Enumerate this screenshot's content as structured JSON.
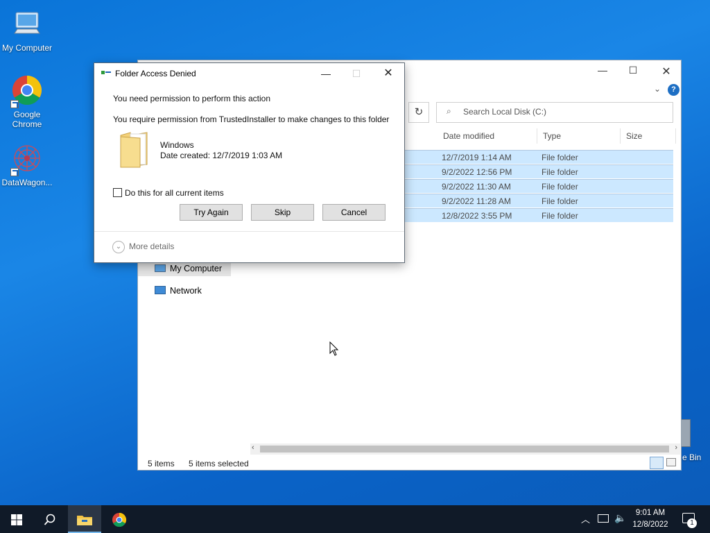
{
  "desktop": {
    "icons": [
      {
        "label": "My Computer"
      },
      {
        "label": "Google Chrome"
      },
      {
        "label": "DataWagon..."
      },
      {
        "label": "e Bin"
      }
    ]
  },
  "explorer": {
    "search_placeholder": "Search Local Disk (C:)",
    "columns": {
      "date": "Date modified",
      "type": "Type",
      "size": "Size"
    },
    "rows": [
      {
        "date": "12/7/2019 1:14 AM",
        "type": "File folder"
      },
      {
        "date": "9/2/2022 12:56 PM",
        "type": "File folder"
      },
      {
        "date": "9/2/2022 11:30 AM",
        "type": "File folder"
      },
      {
        "date": "9/2/2022 11:28 AM",
        "type": "File folder"
      },
      {
        "date": "12/8/2022 3:55 PM",
        "type": "File folder"
      }
    ],
    "nav": {
      "my_computer": "My Computer",
      "network": "Network"
    },
    "status": {
      "items": "5 items",
      "selected": "5 items selected"
    }
  },
  "dialog": {
    "title": "Folder Access Denied",
    "line1": "You need permission to perform this action",
    "line2": "You require permission from TrustedInstaller to make changes to this folder",
    "folder_name": "Windows",
    "folder_date": "Date created: 12/7/2019 1:03 AM",
    "checkbox_label": "Do this for all current items",
    "buttons": {
      "try_again": "Try Again",
      "skip": "Skip",
      "cancel": "Cancel"
    },
    "more_details": "More details"
  },
  "taskbar": {
    "time": "9:01 AM",
    "date": "12/8/2022",
    "notification_count": "1"
  }
}
